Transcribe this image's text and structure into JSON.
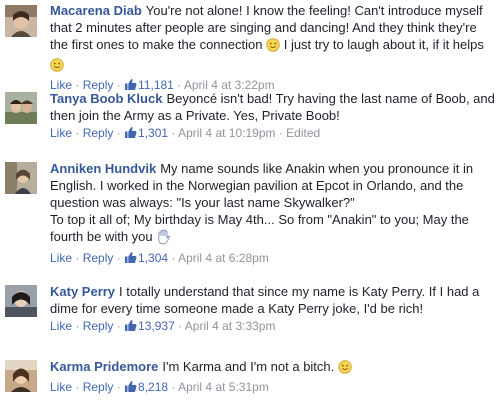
{
  "comments": [
    {
      "author": "Macarena Diab",
      "text1": "You're not alone! I know the feeling! Can't introduce myself that 2 minutes after people are singing and dancing! And they think they're the first ones to make the connection",
      "text2": "I just try to laugh about it, if it helps",
      "like": "Like",
      "reply": "Reply",
      "likes": "11,181",
      "time": "April 4 at 3:22pm",
      "edited": ""
    },
    {
      "author": "Tanya Boob Kluck",
      "text1": "Beyoncé isn't bad! Try having the last name of Boob, and then join the Army as a Private. Yes, Private Boob!",
      "like": "Like",
      "reply": "Reply",
      "likes": "1,301",
      "time": "April 4 at 10:19pm",
      "edited": "Edited"
    },
    {
      "author": "Anniken Hundvik",
      "text1": "My name sounds like Anakin when you pronounce it in English. I worked in the Norwegian pavilion at Epcot in Orlando, and the question was always: \"Is your last name Skywalker?\"",
      "text2": "To top it all of; My birthday is May 4th... So from \"Anakin\" to you; May the fourth be with you",
      "like": "Like",
      "reply": "Reply",
      "likes": "1,304",
      "time": "April 4 at 6:28pm"
    },
    {
      "author": "Katy Perry",
      "text1": "I totally understand that since my name is Katy Perry. If I had a dime for every time someone made a Katy Perry joke, I'd be rich!",
      "like": "Like",
      "reply": "Reply",
      "likes": "13,937",
      "time": "April 4 at 3:33pm"
    },
    {
      "author": "Karma Pridemore",
      "text1": "I'm Karma and I'm not a bitch.",
      "like": "Like",
      "reply": "Reply",
      "likes": "8,218",
      "time": "April 4 at 5:31pm"
    }
  ],
  "icons": {
    "like": "thumbs-up-icon",
    "smile": "smiley-emoji-icon",
    "wave": "waving-hand-emoji-icon"
  },
  "colors": {
    "author": "#365899",
    "action": "#4267b2",
    "meta": "#90949c",
    "text": "#1d2129"
  }
}
